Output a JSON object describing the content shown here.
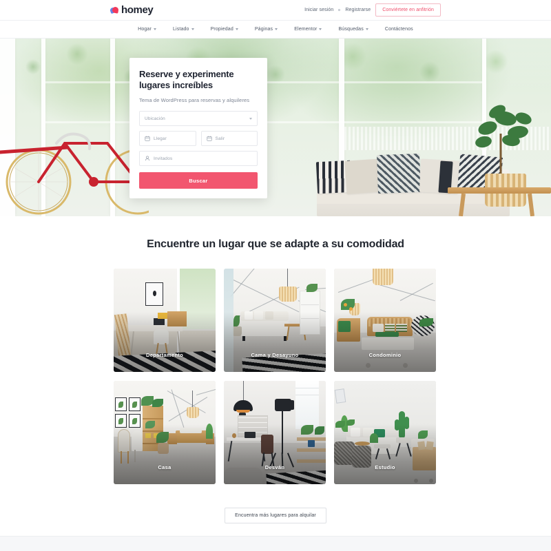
{
  "brand": {
    "name": "homey",
    "logo_icon": "heart-blob-logo",
    "accent": "#f2566f",
    "accent_blue": "#4a6fe3"
  },
  "topbar": {
    "login_label": "Iniciar sesión",
    "separator_icon": "dot-separator",
    "register_label": "Registrarse",
    "host_cta_label": "Conviértete en anfitrión"
  },
  "nav": {
    "items": [
      {
        "label": "Hogar",
        "has_dropdown": true
      },
      {
        "label": "Listado",
        "has_dropdown": true
      },
      {
        "label": "Propiedad",
        "has_dropdown": true
      },
      {
        "label": "Páginas",
        "has_dropdown": true
      },
      {
        "label": "Elementor",
        "has_dropdown": true
      },
      {
        "label": "Búsquedas",
        "has_dropdown": true
      },
      {
        "label": "Contáctenos",
        "has_dropdown": false
      }
    ]
  },
  "hero": {
    "image_description": "Sala de estar luminosa con ventanal, bicicleta roja y sofá con cojines",
    "search_card": {
      "title": "Reserve y experimente lugares increíbles",
      "subtitle": "Tema de WordPress para reservas y alquileres",
      "location_placeholder": "Ubicación",
      "location_icon": "chevron-down-icon",
      "checkin_placeholder": "Llegar",
      "checkin_icon": "calendar-icon",
      "checkout_placeholder": "Salir",
      "checkout_icon": "calendar-icon",
      "guests_placeholder": "Invitados",
      "guests_icon": "user-icon",
      "search_button_label": "Buscar"
    }
  },
  "categories": {
    "heading": "Encuentre un lugar que se adapte a su comodidad",
    "cards": [
      {
        "label": "Departamento",
        "art": "apartment"
      },
      {
        "label": "Cama y Desayuno",
        "art": "bnb"
      },
      {
        "label": "Condominio",
        "art": "condo"
      },
      {
        "label": "Casa",
        "art": "house"
      },
      {
        "label": "Desván",
        "art": "loft"
      },
      {
        "label": "Estudio",
        "art": "studio"
      }
    ],
    "more_button_label": "Encuentra más lugares para alquilar"
  }
}
